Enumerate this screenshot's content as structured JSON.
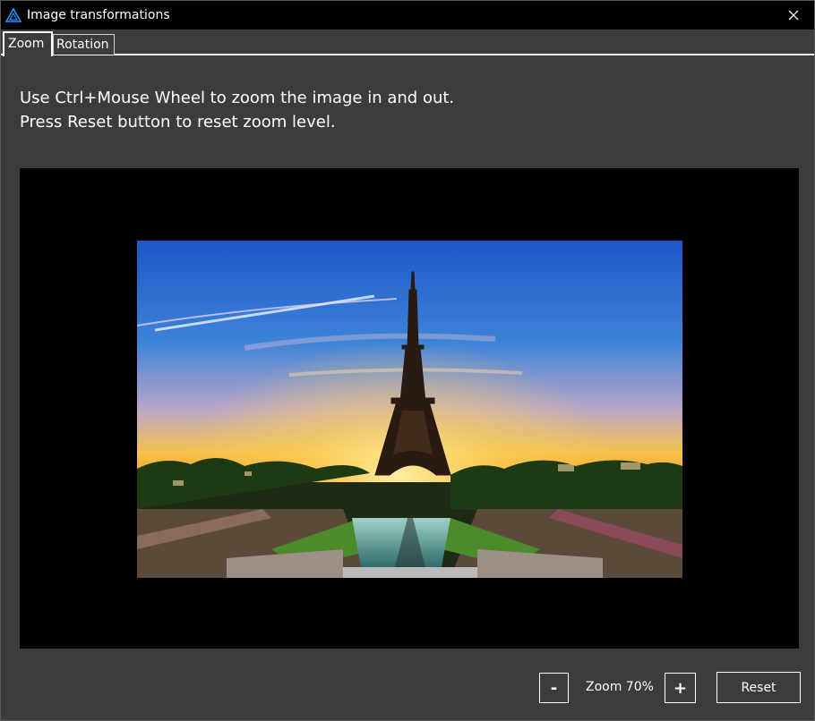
{
  "window": {
    "title": "Image transformations",
    "accent_color": "#1e90ff"
  },
  "tabs": [
    {
      "label": "Zoom",
      "selected": true
    },
    {
      "label": "Rotation",
      "selected": false
    }
  ],
  "instructions": {
    "line1": "Use Ctrl+Mouse Wheel to zoom the image in and out.",
    "line2": "Press Reset button to reset zoom level."
  },
  "controls": {
    "zoom_out_label": "-",
    "zoom_label": "Zoom 70%",
    "zoom_in_label": "+",
    "reset_label": "Reset"
  },
  "icons": {
    "app": "app-logo-triangle-icon",
    "close": "close-icon"
  }
}
